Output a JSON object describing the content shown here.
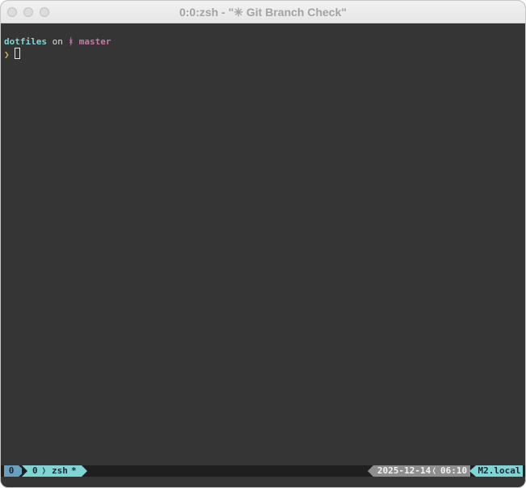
{
  "window": {
    "title": "0:0:zsh - \"✳ Git Branch Check\""
  },
  "terminal": {
    "prompt": {
      "directory": "dotfiles",
      "on_word": "on",
      "branch_icon": "ᚼ",
      "branch": "master",
      "prompt_char": "❯"
    }
  },
  "statusbar": {
    "session": "0",
    "window_index": "0",
    "window_separator": "❭",
    "window_name": "zsh",
    "window_flag": "*",
    "date": "2025-12-14",
    "datetime_separator": "❬",
    "time": "06:10",
    "hostname": "M2.local"
  },
  "colors": {
    "background": "#353535",
    "directory": "#7fd4d4",
    "branch": "#c879a8",
    "prompt_char": "#c8b34c",
    "status_session": "#6a9fbf",
    "status_window": "#7fd4d4",
    "status_datetime": "#8e8e8e",
    "status_host": "#7fd4d4"
  },
  "icons": {
    "branch_icon": "git-branch-icon",
    "close": "close-icon",
    "minimize": "minimize-icon",
    "maximize": "maximize-icon"
  }
}
